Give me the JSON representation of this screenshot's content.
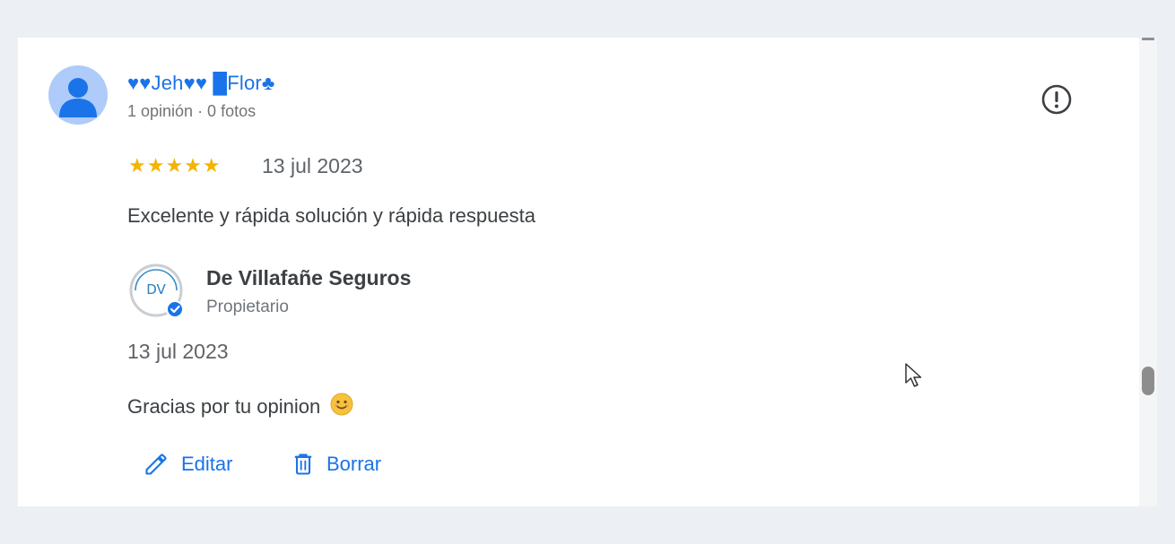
{
  "review": {
    "reviewer_name": "♥♥Jeh♥♥ █Flor♣",
    "reviewer_meta": "1 opinión · 0 fotos",
    "stars": "★★★★★",
    "rating": 5,
    "date": "13 jul 2023",
    "text": "Excelente y rápida solución y rápida respuesta"
  },
  "owner_reply": {
    "logo_text": "DV",
    "owner_name": "De Villafañe Seguros",
    "owner_role": "Propietario",
    "date": "13 jul 2023",
    "text": "Gracias por tu opinion"
  },
  "actions": {
    "edit_label": "Editar",
    "delete_label": "Borrar"
  },
  "icons": {
    "avatar": "person-icon",
    "report": "exclamation-circle-icon",
    "verified": "verified-check-icon",
    "emoji": "smile-emoji-icon",
    "edit": "pencil-icon",
    "delete": "trash-icon",
    "cursor": "mouse-pointer-icon"
  },
  "colors": {
    "accent": "#1a73e8",
    "star": "#f5b400",
    "avatar_bg": "#aecbfa",
    "avatar_fg": "#1a73e8"
  }
}
